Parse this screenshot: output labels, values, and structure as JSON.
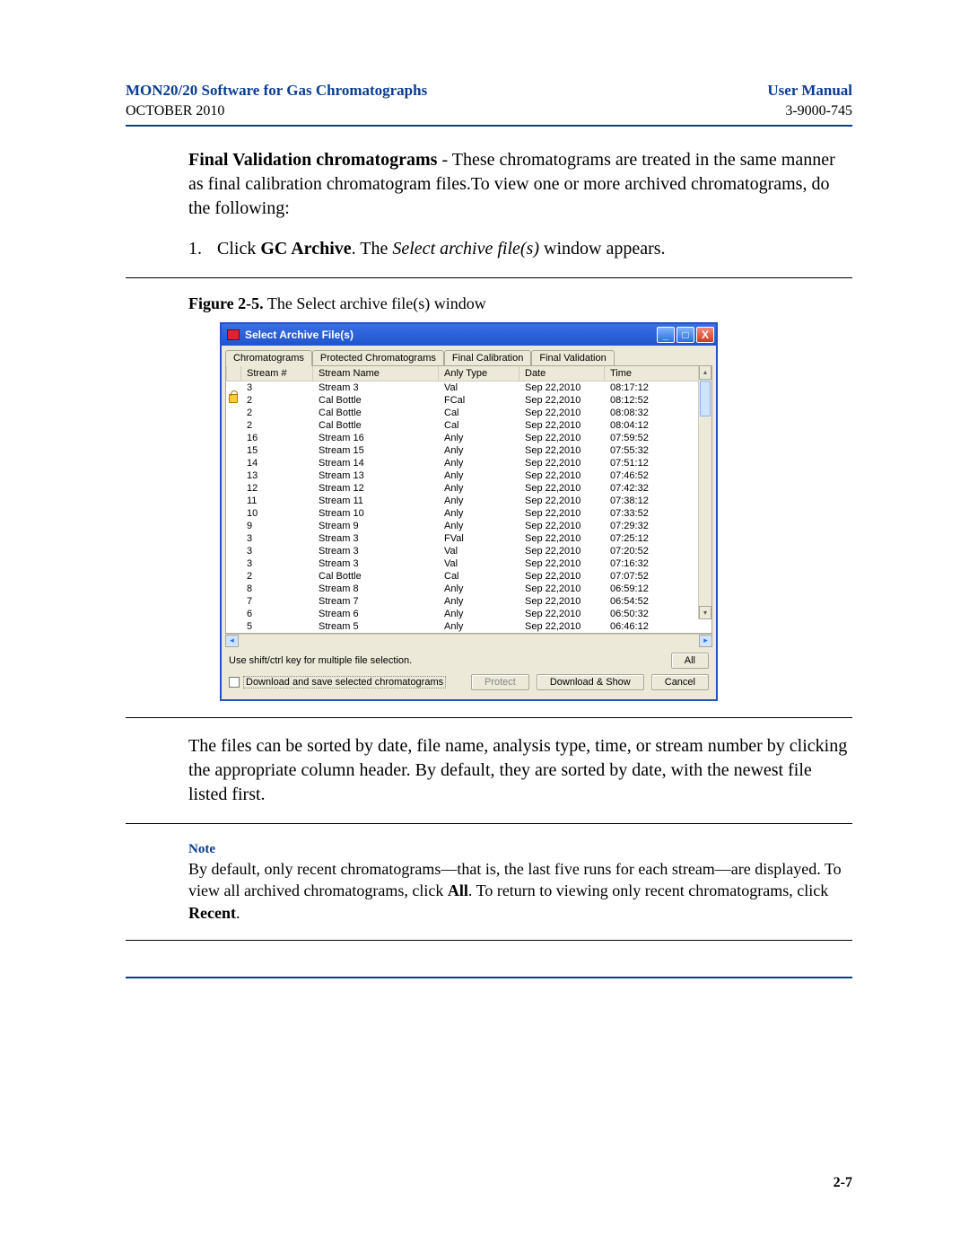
{
  "header": {
    "title_left": "MON20/20 Software for Gas Chromatographs",
    "date_left": "OCTOBER 2010",
    "title_right": "User Manual",
    "docnum_right": "3-9000-745"
  },
  "para1": {
    "lead_bold": "Final Validation chromatograms",
    "rest": " - These chromatograms are treated in the same manner as final calibration chromatogram files.To view one or more archived chromatograms, do the following:"
  },
  "step1": {
    "num": "1.",
    "pre": "Click ",
    "bold": "GC Archive",
    "mid": ". The ",
    "ital": "Select archive file(s)",
    "post": " window appears."
  },
  "figcap": {
    "label": "Figure 2-5.",
    "text": "  The Select archive file(s) window"
  },
  "win": {
    "title": "Select Archive File(s)",
    "tabs": [
      "Chromatograms",
      "Protected Chromatograms",
      "Final Calibration",
      "Final Validation"
    ],
    "headers": [
      "",
      "Stream #",
      "Stream Name",
      "Anly Type",
      "Date",
      "Time"
    ],
    "rows": [
      {
        "lock": false,
        "stream": "3",
        "name": "Stream 3",
        "type": "Val",
        "date": "Sep 22,2010",
        "time": "08:17:12"
      },
      {
        "lock": true,
        "stream": "2",
        "name": "Cal Bottle",
        "type": "FCal",
        "date": "Sep 22,2010",
        "time": "08:12:52"
      },
      {
        "lock": false,
        "stream": "2",
        "name": "Cal Bottle",
        "type": "Cal",
        "date": "Sep 22,2010",
        "time": "08:08:32"
      },
      {
        "lock": false,
        "stream": "2",
        "name": "Cal Bottle",
        "type": "Cal",
        "date": "Sep 22,2010",
        "time": "08:04:12"
      },
      {
        "lock": false,
        "stream": "16",
        "name": "Stream 16",
        "type": "Anly",
        "date": "Sep 22,2010",
        "time": "07:59:52"
      },
      {
        "lock": false,
        "stream": "15",
        "name": "Stream 15",
        "type": "Anly",
        "date": "Sep 22,2010",
        "time": "07:55:32"
      },
      {
        "lock": false,
        "stream": "14",
        "name": "Stream 14",
        "type": "Anly",
        "date": "Sep 22,2010",
        "time": "07:51:12"
      },
      {
        "lock": false,
        "stream": "13",
        "name": "Stream 13",
        "type": "Anly",
        "date": "Sep 22,2010",
        "time": "07:46:52"
      },
      {
        "lock": false,
        "stream": "12",
        "name": "Stream 12",
        "type": "Anly",
        "date": "Sep 22,2010",
        "time": "07:42:32"
      },
      {
        "lock": false,
        "stream": "11",
        "name": "Stream 11",
        "type": "Anly",
        "date": "Sep 22,2010",
        "time": "07:38:12"
      },
      {
        "lock": false,
        "stream": "10",
        "name": "Stream 10",
        "type": "Anly",
        "date": "Sep 22,2010",
        "time": "07:33:52"
      },
      {
        "lock": false,
        "stream": "9",
        "name": "Stream 9",
        "type": "Anly",
        "date": "Sep 22,2010",
        "time": "07:29:32"
      },
      {
        "lock": false,
        "stream": "3",
        "name": "Stream 3",
        "type": "FVal",
        "date": "Sep 22,2010",
        "time": "07:25:12"
      },
      {
        "lock": false,
        "stream": "3",
        "name": "Stream 3",
        "type": "Val",
        "date": "Sep 22,2010",
        "time": "07:20:52"
      },
      {
        "lock": false,
        "stream": "3",
        "name": "Stream 3",
        "type": "Val",
        "date": "Sep 22,2010",
        "time": "07:16:32"
      },
      {
        "lock": false,
        "stream": "2",
        "name": "Cal Bottle",
        "type": "Cal",
        "date": "Sep 22,2010",
        "time": "07:07:52"
      },
      {
        "lock": false,
        "stream": "8",
        "name": "Stream 8",
        "type": "Anly",
        "date": "Sep 22,2010",
        "time": "06:59:12"
      },
      {
        "lock": false,
        "stream": "7",
        "name": "Stream 7",
        "type": "Anly",
        "date": "Sep 22,2010",
        "time": "06:54:52"
      },
      {
        "lock": false,
        "stream": "6",
        "name": "Stream 6",
        "type": "Anly",
        "date": "Sep 22,2010",
        "time": "06:50:32"
      },
      {
        "lock": false,
        "stream": "5",
        "name": "Stream 5",
        "type": "Anly",
        "date": "Sep 22,2010",
        "time": "06:46:12"
      }
    ],
    "hint": "Use shift/ctrl key for multiple file selection.",
    "checkbox_label": "Download and save selected chromatograms",
    "buttons": {
      "all": "All",
      "protect": "Protect",
      "download_show": "Download & Show",
      "cancel": "Cancel"
    }
  },
  "para2": "The files can be sorted by date, file name, analysis type, time, or stream number by clicking the appropriate column header.  By default, they are sorted by date, with the newest file listed first.",
  "note": {
    "label": "Note",
    "t1": "By default, only recent chromatograms—that is, the last five runs for each stream—are displayed.  To view all archived chromatograms, click ",
    "b1": "All",
    "t2": ".  To return to viewing only recent chromatograms, click ",
    "b2": "Recent",
    "t3": "."
  },
  "pagenum": "2-7"
}
